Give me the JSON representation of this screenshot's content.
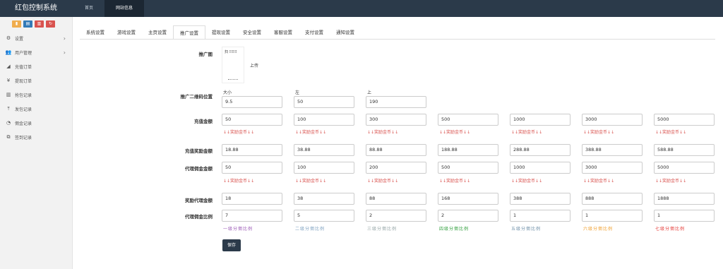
{
  "header": {
    "brand": "红包控制系统",
    "nav": [
      {
        "label": "首页"
      },
      {
        "label": "网站信息"
      }
    ]
  },
  "sidebar": {
    "quick_buttons": [
      {
        "icon": "bar-chart-icon",
        "color": "#f0ad4e"
      },
      {
        "icon": "file-icon",
        "color": "#337ab7"
      },
      {
        "icon": "trash-icon",
        "color": "#d9534f"
      },
      {
        "icon": "refresh-icon",
        "color": "#d9534f"
      }
    ],
    "items": [
      {
        "label": "设置",
        "icon": "gears-icon",
        "chevron": "›"
      },
      {
        "label": "用户管理",
        "icon": "users-icon",
        "chevron": "›"
      },
      {
        "label": "充值订单",
        "icon": "area-chart-icon"
      },
      {
        "label": "提现订单",
        "icon": "yen-icon"
      },
      {
        "label": "抢包记录",
        "icon": "bar-chart-icon"
      },
      {
        "label": "发包记录",
        "icon": "upload-icon"
      },
      {
        "label": "佣金记录",
        "icon": "pie-chart-icon"
      },
      {
        "label": "签到记录",
        "icon": "clone-icon"
      }
    ]
  },
  "tabs": [
    "系统设置",
    "游戏设置",
    "主页设置",
    "推广设置",
    "提现设置",
    "安全设置",
    "客服设置",
    "支付设置",
    "通知设置"
  ],
  "active_tab": 3,
  "form": {
    "promo_image": {
      "label": "推广图",
      "preview_text": "扫 ⠿⠿⠿",
      "upload": "上传"
    },
    "qr_position": {
      "label": "推广二维码位置",
      "fields": [
        {
          "caption": "大小",
          "value": "9.5"
        },
        {
          "caption": "左",
          "value": "50"
        },
        {
          "caption": "上",
          "value": "190"
        }
      ]
    },
    "recharge_amount": {
      "label": "充值金额",
      "values": [
        "50",
        "100",
        "300",
        "500",
        "1000",
        "3000",
        "5000"
      ],
      "hint": "↓↓奖励金币↓↓"
    },
    "recharge_bonus": {
      "label": "充值奖励金额",
      "values": [
        "18.88",
        "38.88",
        "88.88",
        "188.88",
        "288.88",
        "388.88",
        "588.88"
      ]
    },
    "agent_commission_amount": {
      "label": "代理佣金金额",
      "values": [
        "50",
        "100",
        "200",
        "500",
        "1000",
        "3000",
        "5000"
      ],
      "hint": "↓↓奖励金币↓↓"
    },
    "reward_agent_amount": {
      "label": "奖励代理金额",
      "values": [
        "18",
        "38",
        "88",
        "168",
        "388",
        "888",
        "1888"
      ]
    },
    "agent_commission_ratio": {
      "label": "代理佣金比例",
      "values": [
        "7",
        "5",
        "2",
        "2",
        "1",
        "1",
        "1"
      ],
      "levels": [
        {
          "label": "一级分佣比例",
          "color": "#9b59b6"
        },
        {
          "label": "二级分佣比例",
          "color": "#7fa2c0"
        },
        {
          "label": "三级分佣比例",
          "color": "#95a5a6"
        },
        {
          "label": "四级分佣比例",
          "color": "#2e9e3a"
        },
        {
          "label": "五级分佣比例",
          "color": "#6e8fa8"
        },
        {
          "label": "六级分佣比例",
          "color": "#f0a030"
        },
        {
          "label": "七级分佣比例",
          "color": "#e53935"
        }
      ]
    }
  },
  "save_button": "保存"
}
